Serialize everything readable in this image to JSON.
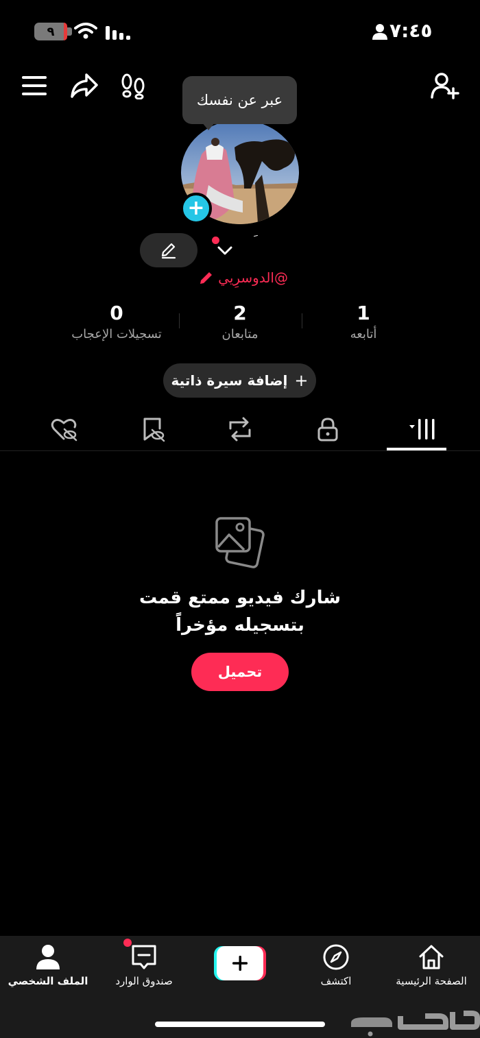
{
  "status_bar": {
    "time": "٧:٤٥",
    "battery": "٩"
  },
  "tooltip": {
    "text": "عبر عن نفسك"
  },
  "profile": {
    "name_mark": "َ",
    "handle": "@الدوسرِيي"
  },
  "stats": [
    {
      "value": "1",
      "label": "أتابعه"
    },
    {
      "value": "2",
      "label": "متابعان"
    },
    {
      "value": "0",
      "label": "تسجيلات الإعجاب"
    }
  ],
  "bio_button": {
    "label": "إضافة سيرة ذاتية",
    "icon": "plus-icon"
  },
  "tabs": [
    {
      "name": "videos",
      "icon": "grid-icon",
      "active": true
    },
    {
      "name": "private",
      "icon": "lock-icon"
    },
    {
      "name": "reposts",
      "icon": "repost-icon"
    },
    {
      "name": "favorites",
      "icon": "bookmark-hidden-icon"
    },
    {
      "name": "liked",
      "icon": "heart-hidden-icon"
    }
  ],
  "empty_state": {
    "line1": "شارك فيديو ممتع قمت",
    "line2": "بتسجيله مؤخراً",
    "button": "تحميل"
  },
  "bottom_nav": {
    "home": "الصفحة الرئيسية",
    "discover": "اكتشف",
    "inbox": "صندوق الوارد",
    "profile": "الملف الشخصي"
  },
  "watermark": "حراج",
  "colors": {
    "accent": "#fe2c55",
    "cyan": "#25c6e6",
    "background": "#000000",
    "surface": "#2b2b2b"
  }
}
